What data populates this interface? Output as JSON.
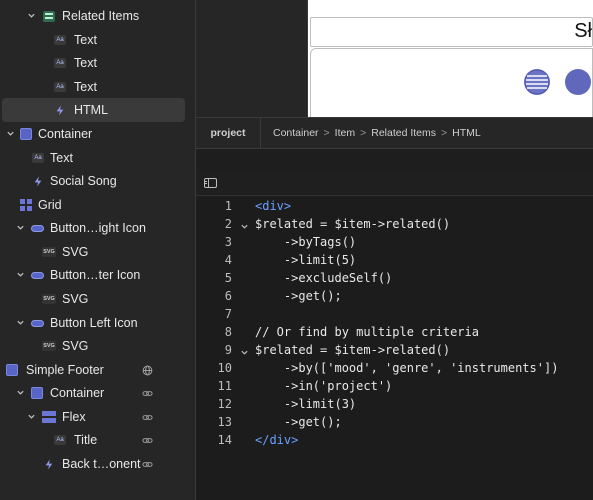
{
  "sidebar": {
    "items": [
      {
        "label": "Related Items",
        "icon": "list-icon"
      },
      {
        "label": "Text",
        "icon": "text-icon"
      },
      {
        "label": "Text",
        "icon": "text-icon"
      },
      {
        "label": "Text",
        "icon": "text-icon"
      },
      {
        "label": "HTML",
        "icon": "bolt-icon"
      },
      {
        "label": "Container",
        "icon": "container-icon"
      },
      {
        "label": "Text",
        "icon": "text-icon"
      },
      {
        "label": "Social Song",
        "icon": "bolt-icon"
      },
      {
        "label": "Grid",
        "icon": "grid-icon"
      },
      {
        "label": "Button…ight Icon",
        "icon": "button-icon"
      },
      {
        "label": "SVG",
        "icon": "svg-icon"
      },
      {
        "label": "Button…ter Icon",
        "icon": "button-icon"
      },
      {
        "label": "SVG",
        "icon": "svg-icon"
      },
      {
        "label": "Button Left Icon",
        "icon": "button-icon"
      },
      {
        "label": "SVG",
        "icon": "svg-icon"
      },
      {
        "label": "Simple Footer",
        "icon": "container-icon"
      },
      {
        "label": "Container",
        "icon": "container-icon"
      },
      {
        "label": "Flex",
        "icon": "flex-icon"
      },
      {
        "label": "Title",
        "icon": "text-icon"
      },
      {
        "label": "Back t…onent",
        "icon": "bolt-icon"
      }
    ],
    "badge_text_icon": "Aa",
    "badge_svg_icon": "SVG",
    "selected": "HTML"
  },
  "preview": {
    "heading_fragment": "Sł"
  },
  "breadcrumb": {
    "tab": "project",
    "items": [
      "Container",
      "Item",
      "Related Items",
      "HTML"
    ],
    "separator": ">"
  },
  "code": {
    "lines": [
      {
        "n": "1",
        "text": "<div>"
      },
      {
        "n": "2",
        "text": "$related = $item->related()"
      },
      {
        "n": "3",
        "text": "    ->byTags()"
      },
      {
        "n": "4",
        "text": "    ->limit(5)"
      },
      {
        "n": "5",
        "text": "    ->excludeSelf()"
      },
      {
        "n": "6",
        "text": "    ->get();"
      },
      {
        "n": "7",
        "text": ""
      },
      {
        "n": "8",
        "text": "// Or find by multiple criteria"
      },
      {
        "n": "9",
        "text": "$related = $item->related()"
      },
      {
        "n": "10",
        "text": "    ->by(['mood', 'genre', 'instruments'])"
      },
      {
        "n": "11",
        "text": "    ->in('project')"
      },
      {
        "n": "12",
        "text": "    ->limit(3)"
      },
      {
        "n": "13",
        "text": "    ->get();"
      },
      {
        "n": "14",
        "text": "</div>"
      }
    ]
  },
  "colors": {
    "accent": "#5865c7",
    "tag": "#6aa0ff",
    "sidebar_bg": "#262626",
    "editor_bg": "#1c1c1c"
  }
}
